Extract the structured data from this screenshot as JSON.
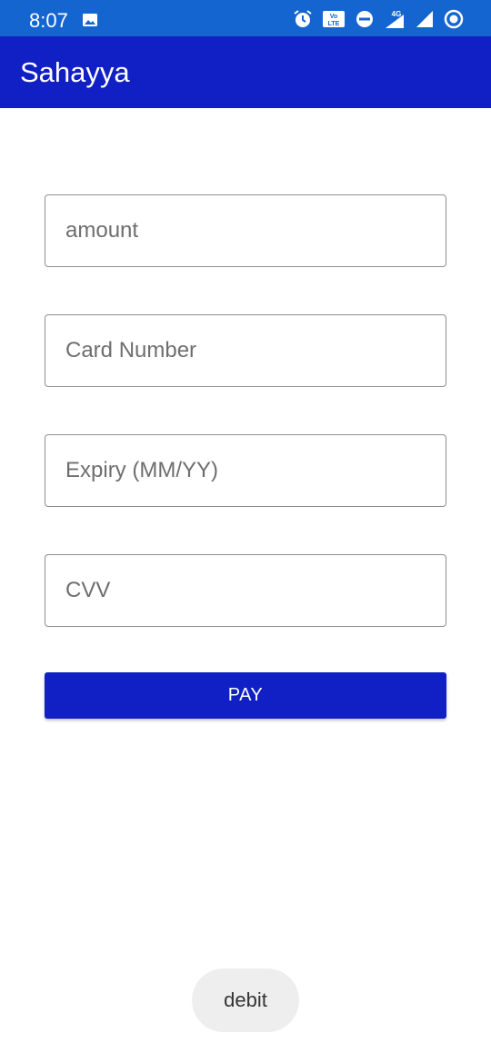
{
  "status_bar": {
    "time": "8:07",
    "color": "#1565d0",
    "icons": [
      "image-icon",
      "alarm-icon",
      "volte-icon",
      "dnd-icon",
      "4g-icon",
      "signal-icon",
      "signal-icon-2",
      "record-icon"
    ]
  },
  "app_bar": {
    "title": "Sahayya",
    "color": "#1120c4"
  },
  "form": {
    "amount_placeholder": "amount",
    "card_number_placeholder": "Card Number",
    "expiry_placeholder": "Expiry (MM/YY)",
    "cvv_placeholder": "CVV",
    "pay_label": "PAY"
  },
  "toast": {
    "text": "debit"
  }
}
